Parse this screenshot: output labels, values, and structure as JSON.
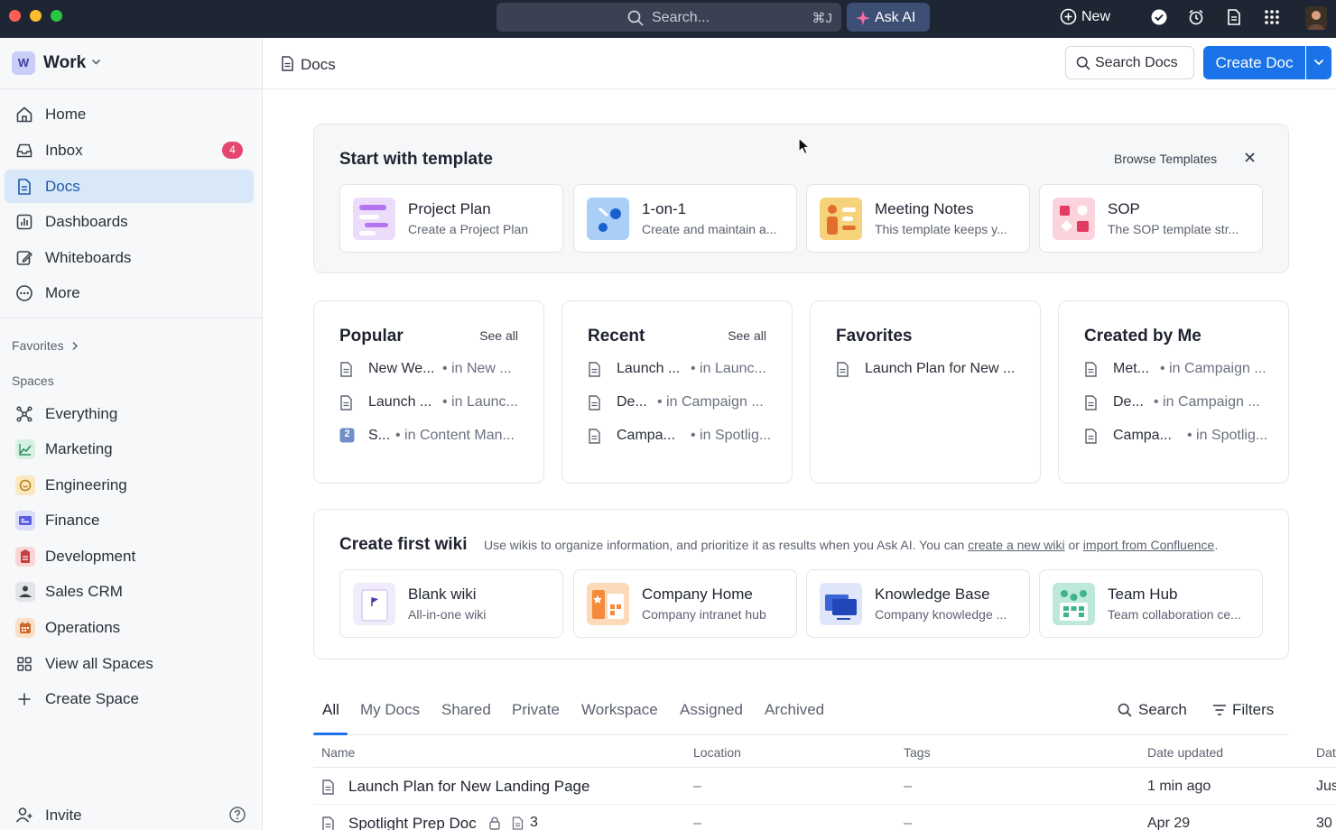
{
  "topbar": {
    "search_placeholder": "Search...",
    "search_shortcut": "⌘J",
    "ask_ai": "Ask AI",
    "new_label": "New"
  },
  "workspace": {
    "initial": "W",
    "name": "Work"
  },
  "nav": [
    {
      "label": "Home",
      "icon": "home-icon"
    },
    {
      "label": "Inbox",
      "icon": "inbox-icon",
      "count": "4"
    },
    {
      "label": "Docs",
      "icon": "doc-icon",
      "active": true
    },
    {
      "label": "Dashboards",
      "icon": "dashboard-icon"
    },
    {
      "label": "Whiteboards",
      "icon": "whiteboard-icon"
    },
    {
      "label": "More",
      "icon": "more-icon"
    }
  ],
  "sidebar": {
    "favorites_label": "Favorites",
    "spaces_label": "Spaces",
    "everything_label": "Everything",
    "spaces": [
      {
        "label": "Marketing",
        "color": "#7fcfa8"
      },
      {
        "label": "Engineering",
        "color": "#f2c46d"
      },
      {
        "label": "Finance",
        "color": "#8f8ff0"
      },
      {
        "label": "Development",
        "color": "#f08a8a"
      },
      {
        "label": "Sales CRM",
        "color": "#c9ccd3"
      },
      {
        "label": "Operations",
        "color": "#f4a96a"
      }
    ],
    "view_all_spaces": "View all Spaces",
    "create_space": "Create Space",
    "invite": "Invite"
  },
  "header": {
    "breadcrumb": "Docs",
    "search_docs": "Search Docs",
    "create_doc": "Create Doc"
  },
  "templates": {
    "title": "Start with template",
    "browse": "Browse Templates",
    "items": [
      {
        "title": "Project Plan",
        "subtitle": "Create a Project Plan"
      },
      {
        "title": "1-on-1",
        "subtitle": "Create and maintain a..."
      },
      {
        "title": "Meeting Notes",
        "subtitle": "This template keeps y..."
      },
      {
        "title": "SOP",
        "subtitle": "The SOP template str..."
      }
    ]
  },
  "lists": {
    "see_all": "See all",
    "popular": {
      "title": "Popular",
      "items": [
        {
          "name": "New We...",
          "loc": "• in New ..."
        },
        {
          "name": "Launch ...",
          "loc": "• in Launc..."
        },
        {
          "name": "S...",
          "loc": "• in Content Man...",
          "badge": "2"
        }
      ]
    },
    "recent": {
      "title": "Recent",
      "items": [
        {
          "name": "Launch ...",
          "loc": "• in Launc..."
        },
        {
          "name": "De...",
          "loc": "• in Campaign ..."
        },
        {
          "name": "Campa...",
          "loc": "• in Spotlig..."
        }
      ]
    },
    "favorites": {
      "title": "Favorites",
      "items": [
        {
          "name": "Launch Plan for New ..."
        }
      ]
    },
    "created": {
      "title": "Created by Me",
      "items": [
        {
          "name": "Met...",
          "loc": "• in Campaign ..."
        },
        {
          "name": "De...",
          "loc": "• in Campaign ..."
        },
        {
          "name": "Campa...",
          "loc": "• in Spotlig..."
        }
      ]
    }
  },
  "wiki": {
    "title": "Create first wiki",
    "desc_prefix": "Use wikis to organize information, and prioritize it as results when you Ask AI. You can ",
    "link_create": "create a new wiki",
    "desc_or": " or ",
    "link_import": "import from Confluence",
    "desc_suffix": ".",
    "items": [
      {
        "title": "Blank wiki",
        "subtitle": "All-in-one wiki"
      },
      {
        "title": "Company Home",
        "subtitle": "Company intranet hub"
      },
      {
        "title": "Knowledge Base",
        "subtitle": "Company knowledge ..."
      },
      {
        "title": "Team Hub",
        "subtitle": "Team collaboration ce..."
      }
    ]
  },
  "tabs": {
    "items": [
      "All",
      "My Docs",
      "Shared",
      "Private",
      "Workspace",
      "Assigned",
      "Archived"
    ],
    "search": "Search",
    "filters": "Filters"
  },
  "table": {
    "columns": [
      "Name",
      "Location",
      "Tags",
      "Date updated",
      "Dat"
    ],
    "rows": [
      {
        "name": "Launch Plan for New Landing Page",
        "location": "–",
        "tags": "–",
        "updated": "1 min ago",
        "extra": "Jus"
      },
      {
        "name": "Spotlight Prep Doc",
        "subcount": "3",
        "location": "–",
        "tags": "–",
        "updated": "Apr 29",
        "extra": "30"
      }
    ]
  },
  "colors": {
    "accent": "#1a73e8",
    "topbar": "#1e2533",
    "active_nav": "#d9e8f8",
    "badge": "#e5456f"
  }
}
